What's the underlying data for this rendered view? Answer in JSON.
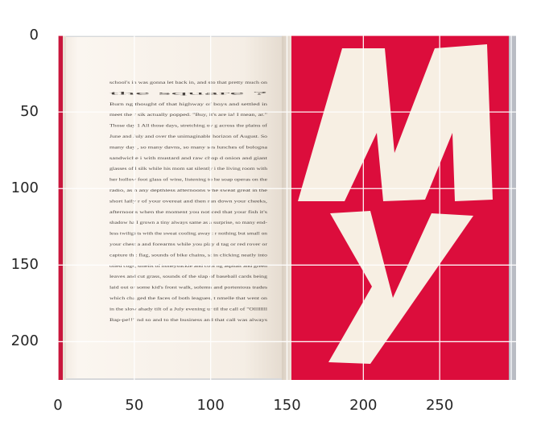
{
  "image": {
    "subject": "open book",
    "left_page_text": [
      "school's in was gonna let back in, and sto  that pretty much on",
      "the square ?",
      "Burn ng thought of that highway of  boys and settled in",
      "meet the r sik actually popped. \"Buy, it's are ia! I mean, ar.\"",
      "Those day 1 All those days, stretching ov  g across the plains of",
      "June and  July and over the unimaginable  horizon of August. So",
      "many day , so many davns, so many ses  lunches of bologna",
      "sandwiche i with mustard and raw chop d onion and giant",
      "glasses of l silk while his mom sat silently i  the living room with",
      "her hollow foot glass of wine, listening to  he soap operas on the",
      "radio, as n any depthless afternoons whe  sweat great in the",
      "short laily r of your overeat and then ran  down your cheeks,",
      "afternoons  when the moment you noticed  that your fish it's",
      "shadow ha I grown a tiny always same as a  surprise, so many end-",
      "less twilig) ts with the sweat cooling away : r nothing but small on",
      "your chest  a and forearms while you play d tag or red rover or",
      "capture th : flag, sounds of bike chains, st  in clicking neatly into",
      "oiled cogs, smells of honeysuckle and cool ng asphalt and green",
      "leaves and cut grass, sounds of the slap of  baseball cards being",
      "laid out or some kid's front walk, solemn  and portentous trades",
      "which cha ged the faces of both leagues, t  nmelle that went on",
      "in the slow  ahady tilt of a July evening ur til the call of \"Ollllllll",
      "Bap-pe!!\"  nd so and to the business and  that call was always"
    ],
    "cover_letters": [
      "M",
      "y"
    ],
    "colors": {
      "cover_red": "#dc0d3c",
      "cover_letter": "#f7efe3",
      "page_paper": "#f6efe6",
      "text_ink": "#4a4440"
    }
  },
  "axes": {
    "xticks": [
      "0",
      "50",
      "100",
      "150",
      "200",
      "250"
    ],
    "yticks": [
      "0",
      "50",
      "100",
      "150",
      "200"
    ],
    "xlim": [
      0,
      300
    ],
    "ylim": [
      225,
      0
    ],
    "grid": true
  }
}
